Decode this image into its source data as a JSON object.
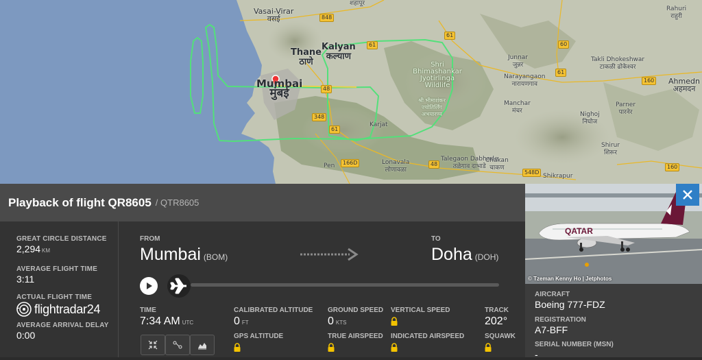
{
  "map": {
    "labels": {
      "vasai_virar": "Vasai-Virar",
      "vasai_virar_local": "वसई",
      "thane": "Thane",
      "thane_local": "ठाणे",
      "kalyan": "Kalyan",
      "kalyan_local": "कल्याण",
      "mumbai": "Mumbai",
      "mumbai_local": "मुंबई",
      "shahapur": "शहापूर",
      "bhimashankar": "Shri Bhimashankar Jyotirlinga Wildlife",
      "bhimashankar_local": "श्री भीमाशंकर ज्योतिर्लिंग अभयारण्य",
      "karjat": "Karjat",
      "lonavala": "Lonavala",
      "lonavala_local": "लोणावळा",
      "pen": "Pen",
      "talegaon": "Talegaon Dabhade",
      "talegaon_local": "तळेगाव दाभाडे",
      "chakan": "Chakan",
      "chakan_local": "चाकण",
      "junnar": "Junnar",
      "junnar_local": "जुन्नर",
      "narayangaon": "Narayangaon",
      "narayangaon_local": "नारायणगाव",
      "manchar": "Manchar",
      "manchar_local": "मंचर",
      "nighoj": "Nighoj",
      "nighoj_local": "निघोज",
      "takli": "Takli Dhokeshwar",
      "takli_local": "टाकळी ढोकेश्वर",
      "parner": "Parner",
      "parner_local": "पारनेर",
      "shirur": "Shirur",
      "shirur_local": "शिरूर",
      "shikrapur": "Shikrapur",
      "ahmednagar": "Ahmedn",
      "ahmednagar_local": "अहमदन",
      "rahuri": "Rahuri",
      "rahuri_local": "राहुरी"
    },
    "roads": [
      "848",
      "61",
      "60",
      "61",
      "61",
      "48",
      "348",
      "61",
      "48",
      "166D",
      "548D",
      "160",
      "160"
    ]
  },
  "flight": {
    "title": "Playback of flight QR8605",
    "callsign": "/ QTR8605"
  },
  "stats": {
    "distance_label": "GREAT CIRCLE DISTANCE",
    "distance_value": "2,294",
    "distance_unit": "KM",
    "avg_time_label": "AVERAGE FLIGHT TIME",
    "avg_time_value": "3:11",
    "actual_time_label": "ACTUAL FLIGHT TIME",
    "actual_time_value": "-",
    "delay_label": "AVERAGE ARRIVAL DELAY",
    "delay_value": "0:00"
  },
  "logo": {
    "brand": "flightradar24"
  },
  "route": {
    "from_label": "FROM",
    "from_city": "Mumbai",
    "from_code": "(BOM)",
    "to_label": "TO",
    "to_city": "Doha",
    "to_code": "(DOH)"
  },
  "data": {
    "time_label": "TIME",
    "time_value": "7:34 AM",
    "time_unit": "UTC",
    "cal_alt_label": "CALIBRATED ALTITUDE",
    "cal_alt_value": "0",
    "cal_alt_unit": "FT",
    "gps_alt_label": "GPS ALTITUDE",
    "ground_speed_label": "GROUND SPEED",
    "ground_speed_value": "0",
    "ground_speed_unit": "KTS",
    "true_airspeed_label": "TRUE AIRSPEED",
    "vertical_speed_label": "VERTICAL SPEED",
    "indicated_airspeed_label": "INDICATED AIRSPEED",
    "track_label": "TRACK",
    "track_value": "202°",
    "squawk_label": "SQUAWK"
  },
  "aircraft": {
    "photo_credit": "© Tzeman Kenny Ho | Jetphotos",
    "aircraft_label": "AIRCRAFT",
    "aircraft_value": "Boeing 777-FDZ",
    "registration_label": "REGISTRATION",
    "registration_value": "A7-BFF",
    "serial_label": "SERIAL NUMBER (MSN)",
    "serial_value": "-",
    "livery_text": "QATAR"
  },
  "colors": {
    "track_green": "#53e07a",
    "header_bg": "#4a4a4a",
    "panel_bg": "#333333",
    "close_blue": "#2f7fc6",
    "lock_yellow": "#f3c200"
  }
}
